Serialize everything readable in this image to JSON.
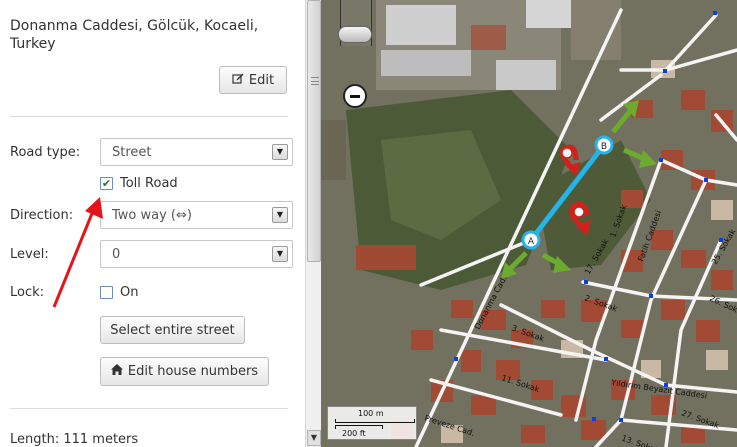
{
  "segment": {
    "address": "Donanma Caddesi, Gölcük, Kocaeli, Turkey",
    "edit_label": "Edit"
  },
  "fields": {
    "road_type_label": "Road type:",
    "road_type_value": "Street",
    "toll_road_label": "Toll Road",
    "toll_road_checked": true,
    "direction_label": "Direction:",
    "direction_value": "Two way (⇔)",
    "level_label": "Level:",
    "level_value": "0",
    "lock_label": "Lock:",
    "lock_on_label": "On",
    "lock_checked": false
  },
  "actions": {
    "select_street_label": "Select entire street",
    "edit_house_numbers_label": "Edit house numbers"
  },
  "info": {
    "length_text": "Length: 111 meters"
  },
  "map": {
    "node_a_label": "A",
    "node_b_label": "B",
    "scale_metric": "100 m",
    "scale_imperial": "200 ft",
    "street_labels": {
      "donanma": "Donanma Cad.",
      "sokak_2": "2. Sokak",
      "sokak_3": "3. Sokak",
      "sokak_1": "1. Sokak",
      "sokak_17": "17. Sokak",
      "fatih": "Fatih Caddesi",
      "sokak_26": "26. Sokak",
      "sokak_25": "25. Sokak",
      "yildirim": "Yıldırım Beyazıt Caddesi",
      "sokak_11": "11. Sokak",
      "sokak_27": "27. Sokak",
      "preveze": "Preveze Cad.",
      "sokak_13": "13. Sokak"
    },
    "colors": {
      "selected_segment": "#25b4e8",
      "allowed_arrow": "#6cab2e",
      "restricted_turn": "#d0221b",
      "node_blue": "#0a3ee8",
      "annotation_arrow": "#e4141b"
    }
  }
}
